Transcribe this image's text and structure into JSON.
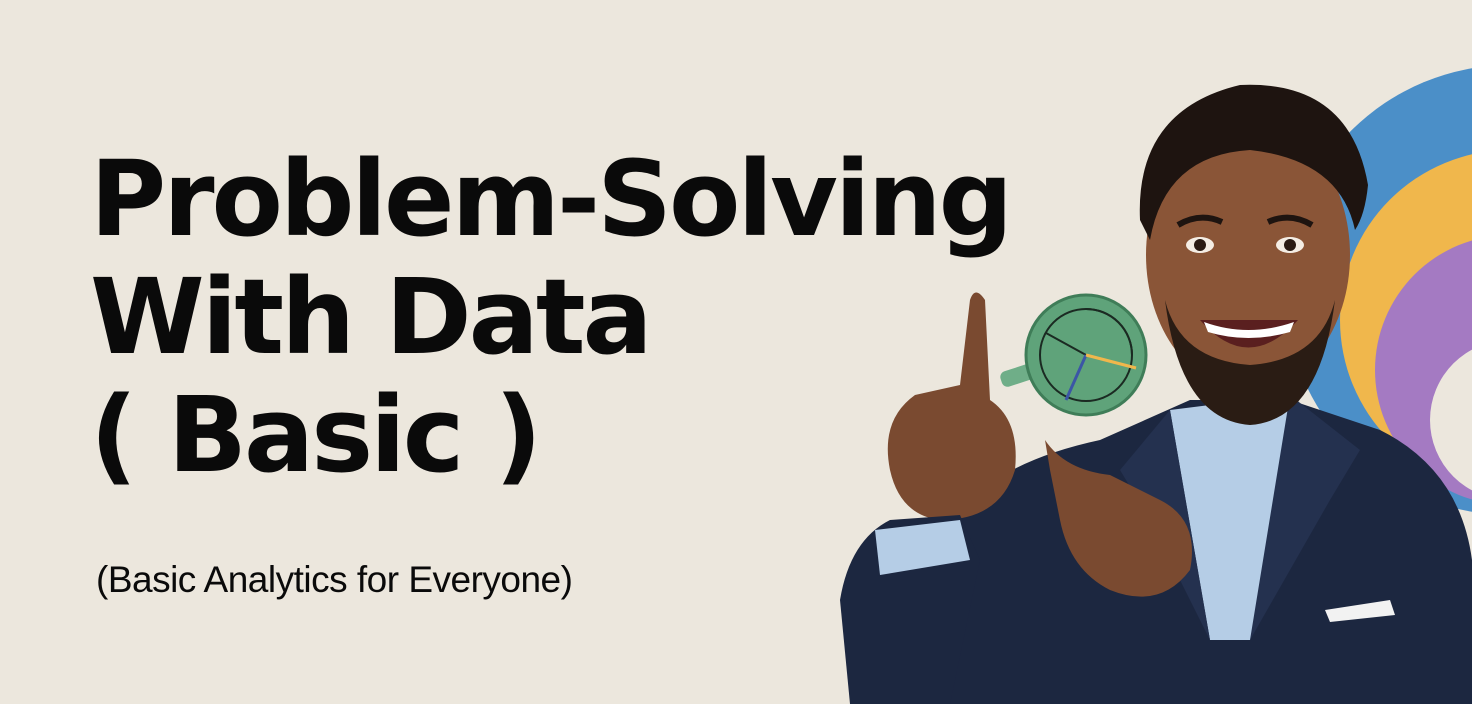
{
  "banner": {
    "title_lines": [
      "Problem-Solving",
      "With Data",
      "( Basic )"
    ],
    "subtitle": "(Basic Analytics for Everyone)"
  },
  "colors": {
    "background": "#ece7dd",
    "text": "#0a0a0a",
    "arc_blue": "#4b8fc8",
    "arc_yellow": "#f0b74c",
    "arc_purple": "#a47ac2",
    "magnifier_green": "#5fa37a",
    "suit_navy": "#1c2740",
    "shirt_blue": "#b5cde6",
    "skin": "#8a5537"
  },
  "illustration": {
    "subject": "smiling man in navy suit pointing at a magnifying glass",
    "icons": [
      "magnifier-icon",
      "pie-chart-icon"
    ]
  }
}
